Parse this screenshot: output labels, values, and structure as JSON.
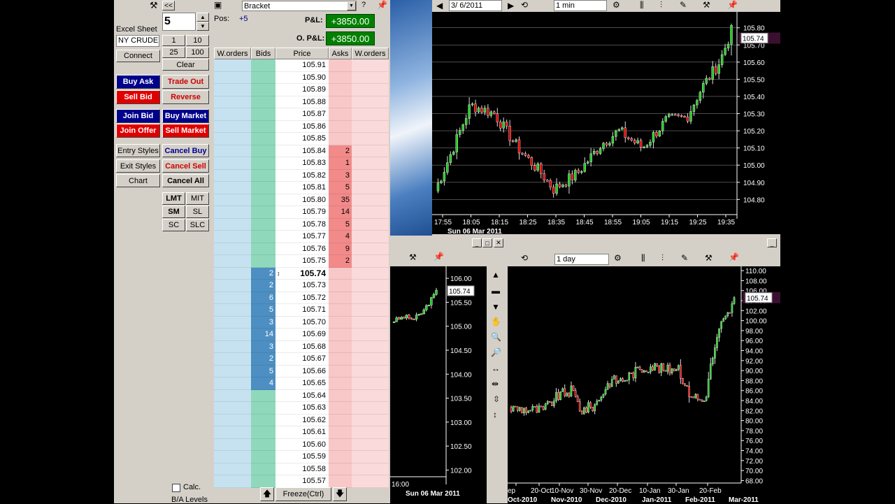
{
  "toolbar": {
    "back_label": "<<",
    "qty_value": "5",
    "excel_label": "Excel Sheet",
    "instrument": "NY CRUDE",
    "connect_label": "Connect",
    "qty_presets": [
      "1",
      "10",
      "25",
      "100"
    ],
    "clear_label": "Clear",
    "buy_ask": "Buy Ask",
    "trade_out": "Trade Out",
    "sell_bid": "Sell Bid",
    "reverse": "Reverse",
    "join_bid": "Join Bid",
    "buy_market": "Buy Market",
    "join_offer": "Join Offer",
    "sell_market": "Sell Market",
    "entry_styles": "Entry Styles",
    "cancel_buy": "Cancel Buy",
    "exit_styles": "Exit Styles",
    "cancel_sell": "Cancel Sell",
    "chart": "Chart",
    "cancel_all": "Cancel All",
    "order_types": [
      "LMT",
      "MIT",
      "SM",
      "SL",
      "SC",
      "SLC"
    ],
    "calc_label": "Calc.",
    "ba_levels_label": "B/A Levels"
  },
  "ladder": {
    "strategy": "Bracket",
    "pos_label": "Pos:",
    "pos_value": "+5",
    "pl_label": "P&L:",
    "pl_value": "+3850.00",
    "opl_label": "O. P&L:",
    "opl_value": "+3850.00",
    "headers": [
      "W.orders",
      "Bids",
      "Price",
      "Asks",
      "W.orders"
    ],
    "current_price": "105.74",
    "freeze_label": "Freeze(Ctrl)",
    "rows": [
      {
        "price": "105.91",
        "bid": "",
        "ask": ""
      },
      {
        "price": "105.90",
        "bid": "",
        "ask": ""
      },
      {
        "price": "105.89",
        "bid": "",
        "ask": ""
      },
      {
        "price": "105.88",
        "bid": "",
        "ask": ""
      },
      {
        "price": "105.87",
        "bid": "",
        "ask": ""
      },
      {
        "price": "105.86",
        "bid": "",
        "ask": ""
      },
      {
        "price": "105.85",
        "bid": "",
        "ask": ""
      },
      {
        "price": "105.84",
        "bid": "",
        "ask": "2"
      },
      {
        "price": "105.83",
        "bid": "",
        "ask": "1"
      },
      {
        "price": "105.82",
        "bid": "",
        "ask": "3"
      },
      {
        "price": "105.81",
        "bid": "",
        "ask": "5"
      },
      {
        "price": "105.80",
        "bid": "",
        "ask": "35"
      },
      {
        "price": "105.79",
        "bid": "",
        "ask": "14"
      },
      {
        "price": "105.78",
        "bid": "",
        "ask": "5"
      },
      {
        "price": "105.77",
        "bid": "",
        "ask": "4"
      },
      {
        "price": "105.76",
        "bid": "",
        "ask": "9"
      },
      {
        "price": "105.75",
        "bid": "",
        "ask": "2"
      },
      {
        "price": "105.74",
        "bid": "2",
        "ask": ""
      },
      {
        "price": "105.73",
        "bid": "2",
        "ask": ""
      },
      {
        "price": "105.72",
        "bid": "6",
        "ask": ""
      },
      {
        "price": "105.71",
        "bid": "5",
        "ask": ""
      },
      {
        "price": "105.70",
        "bid": "3",
        "ask": ""
      },
      {
        "price": "105.69",
        "bid": "14",
        "ask": ""
      },
      {
        "price": "105.68",
        "bid": "3",
        "ask": ""
      },
      {
        "price": "105.67",
        "bid": "2",
        "ask": ""
      },
      {
        "price": "105.66",
        "bid": "5",
        "ask": ""
      },
      {
        "price": "105.65",
        "bid": "4",
        "ask": ""
      },
      {
        "price": "105.64",
        "bid": "",
        "ask": ""
      },
      {
        "price": "105.63",
        "bid": "",
        "ask": ""
      },
      {
        "price": "105.62",
        "bid": "",
        "ask": ""
      },
      {
        "price": "105.61",
        "bid": "",
        "ask": ""
      },
      {
        "price": "105.60",
        "bid": "",
        "ask": ""
      },
      {
        "price": "105.59",
        "bid": "",
        "ask": ""
      },
      {
        "price": "105.58",
        "bid": "",
        "ask": ""
      },
      {
        "price": "105.57",
        "bid": "",
        "ask": ""
      }
    ]
  },
  "chart_top": {
    "date": "3/ 6/2011",
    "interval": "1 min",
    "last_price": "105.74",
    "y_ticks": [
      "105.80",
      "105.70",
      "105.60",
      "105.50",
      "105.40",
      "105.30",
      "105.20",
      "105.10",
      "105.00",
      "104.90",
      "104.80"
    ],
    "x_ticks": [
      "17:55",
      "18:05",
      "18:15",
      "18:25",
      "18:35",
      "18:45",
      "18:55",
      "19:05",
      "19:15",
      "19:25",
      "19:35"
    ],
    "date_label": "Sun 06 Mar 2011"
  },
  "chart_mid": {
    "last_price": "105.74",
    "y_ticks": [
      "106.00",
      "105.50",
      "105.00",
      "104.50",
      "104.00",
      "103.50",
      "103.00",
      "102.50",
      "102.00"
    ],
    "x_tick": "16:00",
    "date_label": "Sun 06 Mar 2011"
  },
  "chart_daily": {
    "interval": "1 day",
    "last_price": "105.74",
    "y_ticks": [
      "110.00",
      "108.00",
      "106.00",
      "104.00",
      "102.00",
      "100.00",
      "98.00",
      "96.00",
      "94.00",
      "92.00",
      "90.00",
      "88.00",
      "86.00",
      "84.00",
      "82.00",
      "80.00",
      "78.00",
      "76.00",
      "74.00",
      "72.00",
      "70.00",
      "68.00"
    ],
    "x_ticks": [
      "ep",
      "20-Oct",
      "10-Nov",
      "30-Nov",
      "20-Dec",
      "10-Jan",
      "30-Jan",
      "20-Feb"
    ],
    "months": [
      "Oct-2010",
      "Nov-2010",
      "Dec-2010",
      "Jan-2011",
      "Feb-2011",
      "Mar-2011"
    ]
  },
  "colors": {
    "up": "#22cc22",
    "down": "#dd0000",
    "bg": "#000000",
    "panel": "#d4d0c8"
  }
}
